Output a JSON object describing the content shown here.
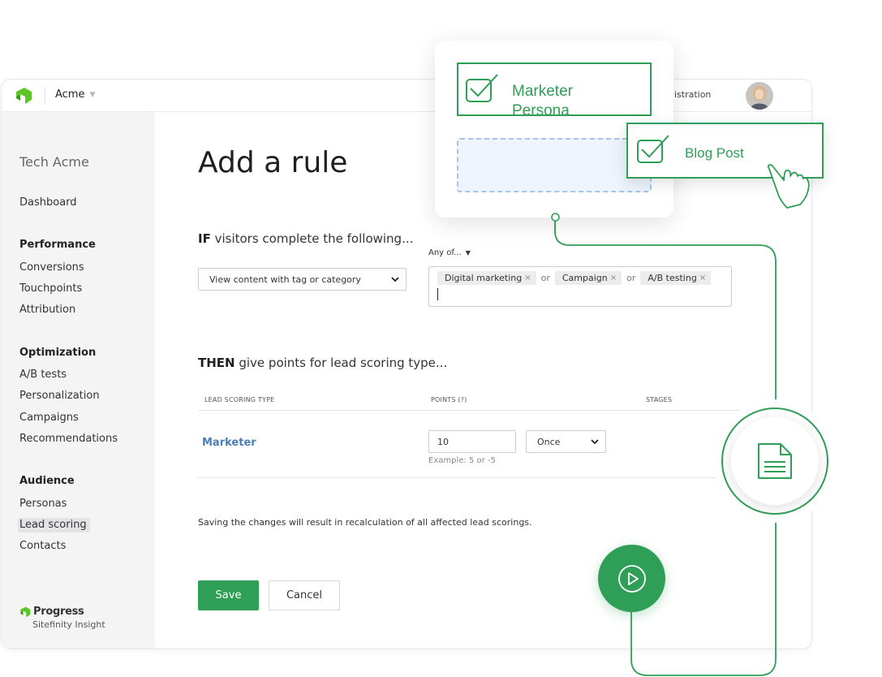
{
  "topbar": {
    "org_name": "Acme",
    "admin_link": "nistration"
  },
  "sidebar": {
    "tenant": "Tech Acme",
    "dashboard": "Dashboard",
    "sections": [
      {
        "title": "Performance",
        "items": [
          "Conversions",
          "Touchpoints",
          "Attribution"
        ]
      },
      {
        "title": "Optimization",
        "items": [
          "A/B tests",
          "Personalization",
          "Campaigns",
          "Recommendations"
        ]
      },
      {
        "title": "Audience",
        "items": [
          "Personas",
          "Lead scoring",
          "Contacts"
        ]
      }
    ],
    "active_item": "Lead scoring",
    "brand_name": "Progress",
    "brand_product": "Sitefinity Insight"
  },
  "main": {
    "title": "Add a rule",
    "if_keyword": "IF",
    "if_text": " visitors complete the following...",
    "condition_select": "View content with tag or category",
    "any_of_label": "Any of...",
    "tags": [
      "Digital marketing",
      "Campaign",
      "A/B testing"
    ],
    "or_word": "or",
    "then_keyword": "THEN",
    "then_text": " give points for lead scoring type...",
    "columns": {
      "type": "LEAD SCORING TYPE",
      "points": "POINTS (?)",
      "stages": "STAGES"
    },
    "row": {
      "type": "Marketer",
      "points": "10",
      "points_hint": "Example: 5 or -5",
      "frequency": "Once"
    },
    "notice": "Saving the changes will result in recalculation of all affected lead scorings.",
    "save_label": "Save",
    "cancel_label": "Cancel"
  },
  "overlay": {
    "persona_card": "Marketer Persona",
    "blog_card": "Blog Post"
  },
  "colors": {
    "accent_green": "#2f9e57",
    "link_blue": "#4a7fb5",
    "dropzone_blue": "#a6c4ee"
  }
}
